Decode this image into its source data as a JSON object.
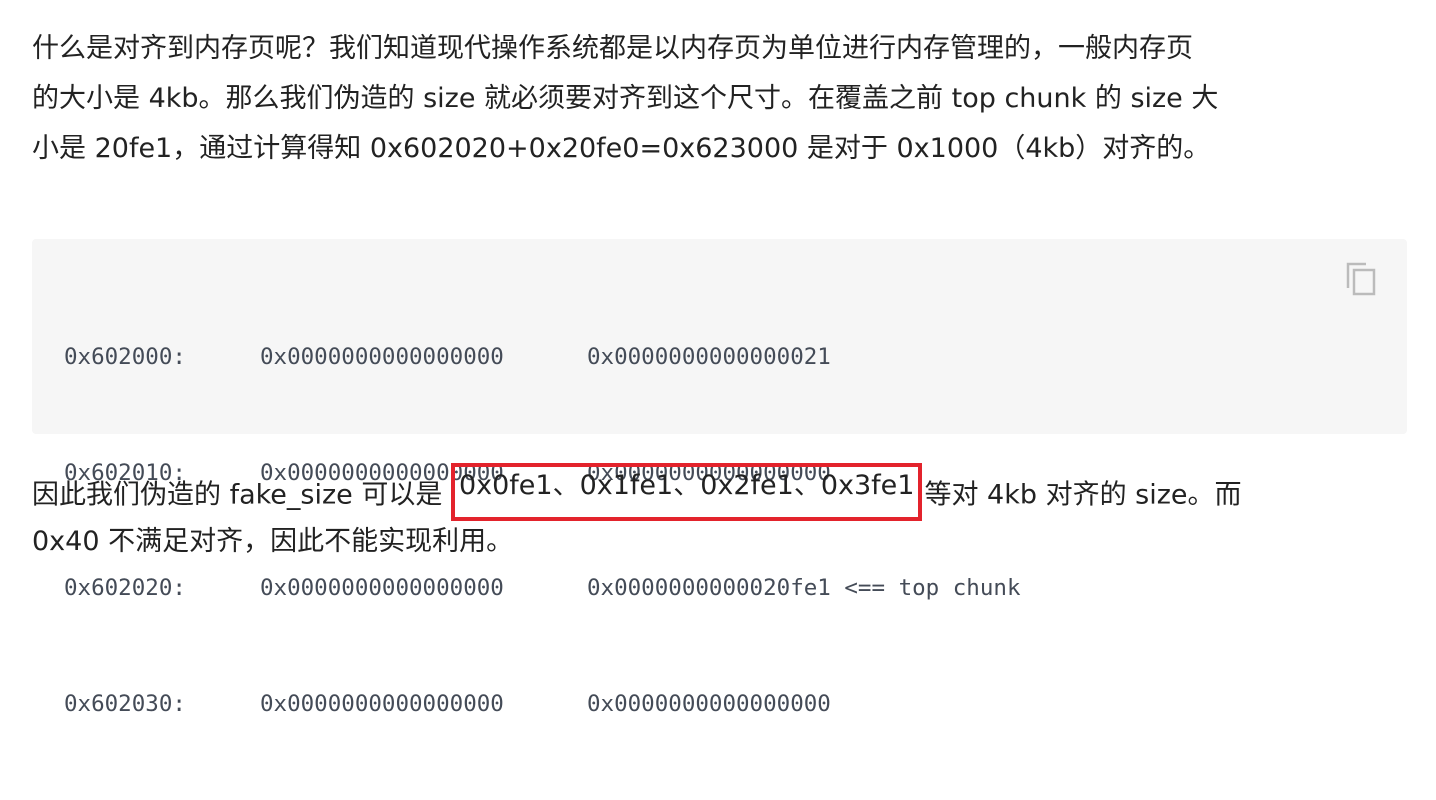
{
  "intro": {
    "line1": "什么是对齐到内存页呢？我们知道现代操作系统都是以内存页为单位进行内存管理的，一般内存页",
    "line2": "的大小是 4kb。那么我们伪造的 size 就必须要对齐到这个尺寸。在覆盖之前 top chunk 的 size 大",
    "line3": "小是 20fe1，通过计算得知 0x602020+0x20fe0=0x623000 是对于 0x1000（4kb）对齐的。"
  },
  "code": {
    "copy_icon": "copy-icon",
    "rows": [
      {
        "addr": "0x602000:",
        "w1": "0x0000000000000000",
        "w2": "0x0000000000000021",
        "note": ""
      },
      {
        "addr": "0x602010:",
        "w1": "0x0000000000000000",
        "w2": "0x0000000000000000",
        "note": ""
      },
      {
        "addr": "0x602020:",
        "w1": "0x0000000000000000",
        "w2": "0x0000000000020fe1",
        "note": " <== top chunk"
      },
      {
        "addr": "0x602030:",
        "w1": "0x0000000000000000",
        "w2": "0x0000000000000000",
        "note": ""
      }
    ]
  },
  "conclusion": {
    "before": "因此我们伪造的 fake_size 可以是 ",
    "highlighted": "0x0fe1、0x1fe1、0x2fe1、0x3fe1",
    "after": "等对 4kb 对齐的 size。而",
    "line2": "0x40 不满足对齐，因此不能实现利用。"
  },
  "colors": {
    "text": "#222222",
    "code_bg": "#f6f6f6",
    "code_text": "#444b57",
    "highlight_border": "#e3232c",
    "icon": "#bbbbbb"
  }
}
